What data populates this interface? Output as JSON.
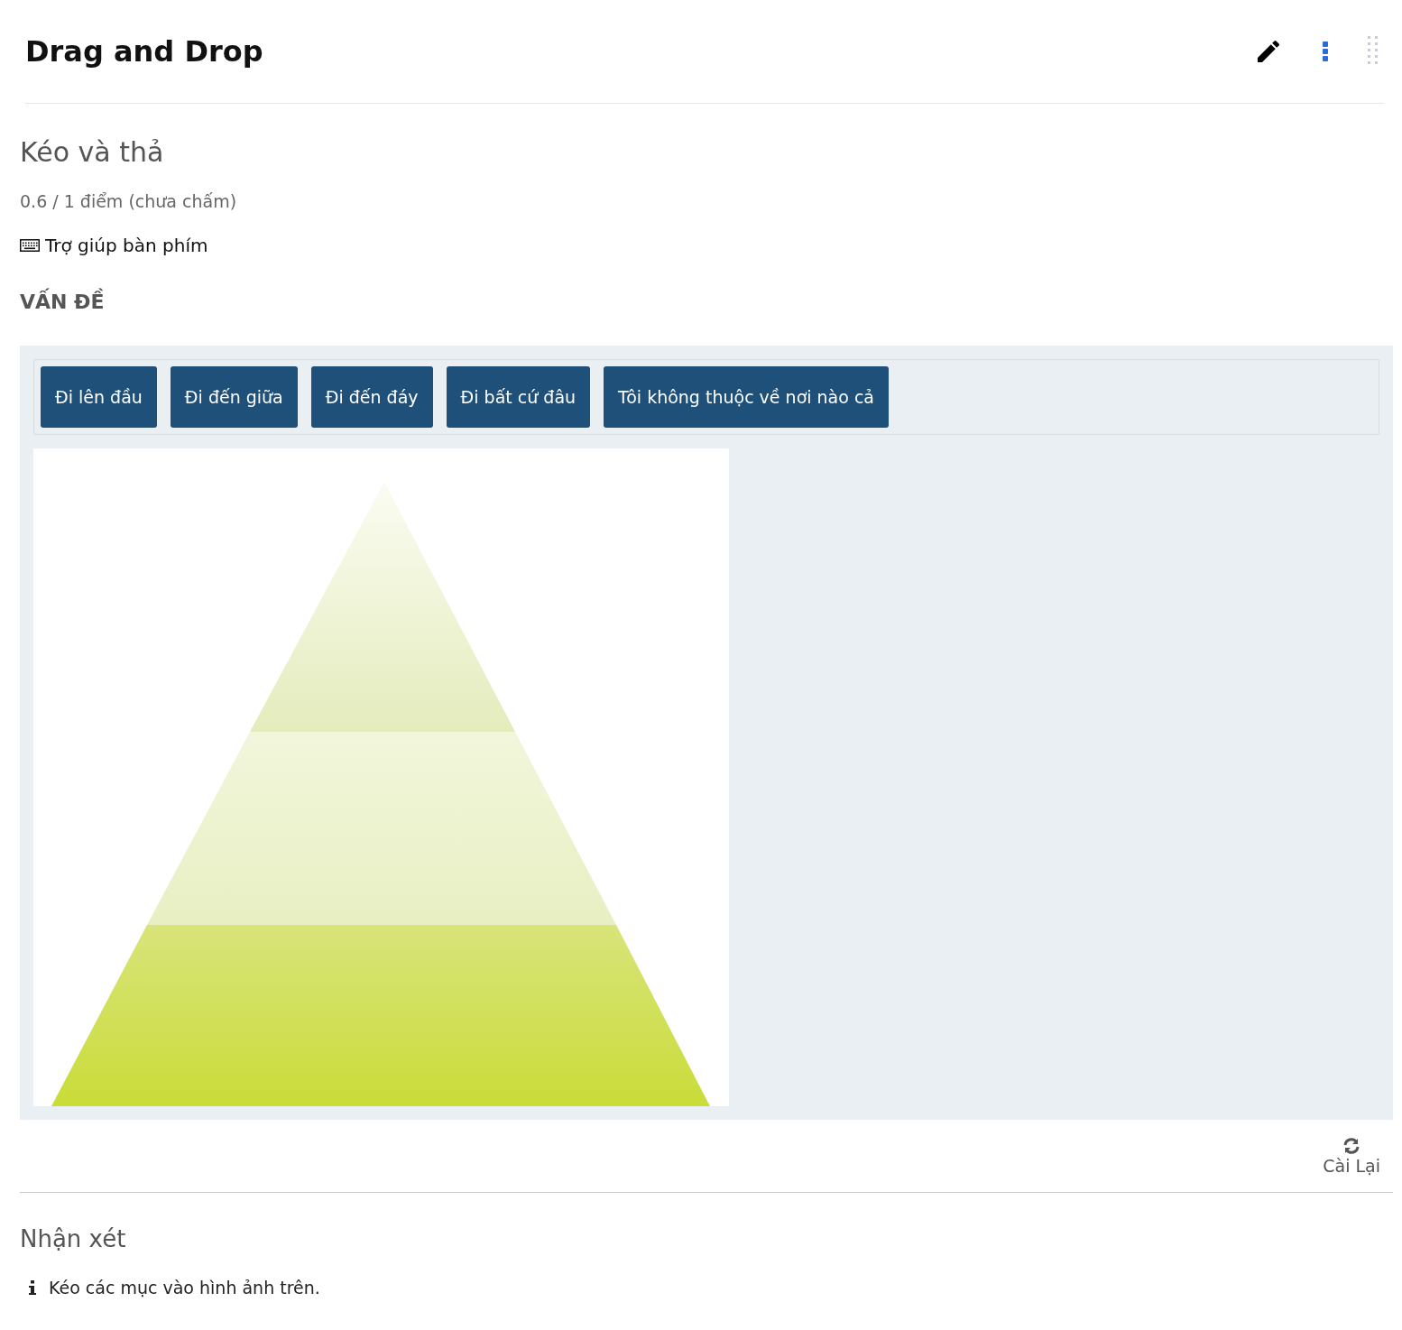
{
  "header": {
    "title": "Drag and Drop"
  },
  "problem": {
    "title": "Kéo và thả",
    "score": "0.6 / 1 điểm (chưa chấm)",
    "keyboard_help": "Trợ giúp bàn phím",
    "section_label": "VẤN ĐỀ",
    "items": [
      {
        "label": "Đi lên đầu"
      },
      {
        "label": "Đi đến giữa"
      },
      {
        "label": "Đi đến đáy"
      },
      {
        "label": "Đi bất cứ đâu"
      },
      {
        "label": "Tôi không thuộc về nơi nào cả"
      }
    ],
    "reset": "Cài Lại"
  },
  "feedback": {
    "title": "Nhận xét",
    "message": "Kéo các mục vào hình ảnh trên."
  }
}
